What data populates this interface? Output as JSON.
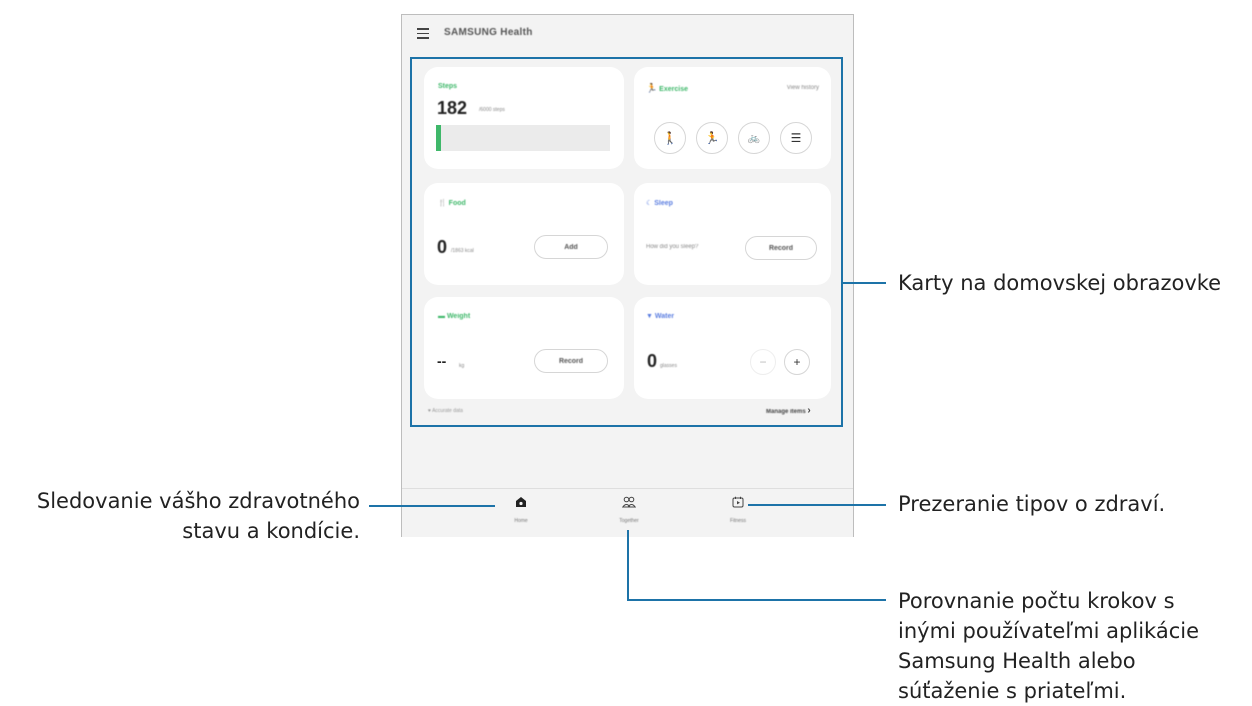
{
  "app": {
    "title": "SAMSUNG Health"
  },
  "cards": {
    "steps": {
      "title": "Steps",
      "value": "182",
      "unit": "/6000 steps",
      "progress_fraction": 0.03,
      "accent": "#3fb86a"
    },
    "exercise": {
      "title": "Exercise",
      "link": "View history",
      "buttons": [
        "walking-icon",
        "running-icon",
        "cycling-icon",
        "list-icon"
      ],
      "accent": "#3fb86a"
    },
    "food": {
      "title": "Food",
      "value": "0",
      "unit": "/1863 kcal",
      "button_label": "Add",
      "accent": "#3fb86a"
    },
    "sleep": {
      "title": "Sleep",
      "prompt": "How did you sleep?",
      "button_label": "Record",
      "accent": "#5a7de0"
    },
    "weight": {
      "title": "Weight",
      "value": "--",
      "unit": "kg",
      "button_label": "Record",
      "accent": "#3fb86a"
    },
    "water": {
      "title": "Water",
      "value": "0",
      "unit": "glasses",
      "minus": "−",
      "plus": "+",
      "accent": "#5a7de0"
    }
  },
  "footer": {
    "left_note": "Accurate data",
    "manage_items": "Manage items",
    "chevron": "›"
  },
  "nav": {
    "home": "Home",
    "together": "Together",
    "fitness": "Fitness"
  },
  "callouts": {
    "cards": "Karty na domovskej obrazovke",
    "home_line1": "Sledovanie vášho zdravotného",
    "home_line2": "stavu a kondície.",
    "tips": "Prezeranie tipov o zdraví.",
    "together_line1": "Porovnanie počtu krokov s",
    "together_line2": "inými používateľmi aplikácie",
    "together_line3": "Samsung Health alebo",
    "together_line4": "súťaženie s priateľmi."
  },
  "colors": {
    "callout_line": "#1d73a8",
    "device_bg": "#f3f3f3"
  }
}
